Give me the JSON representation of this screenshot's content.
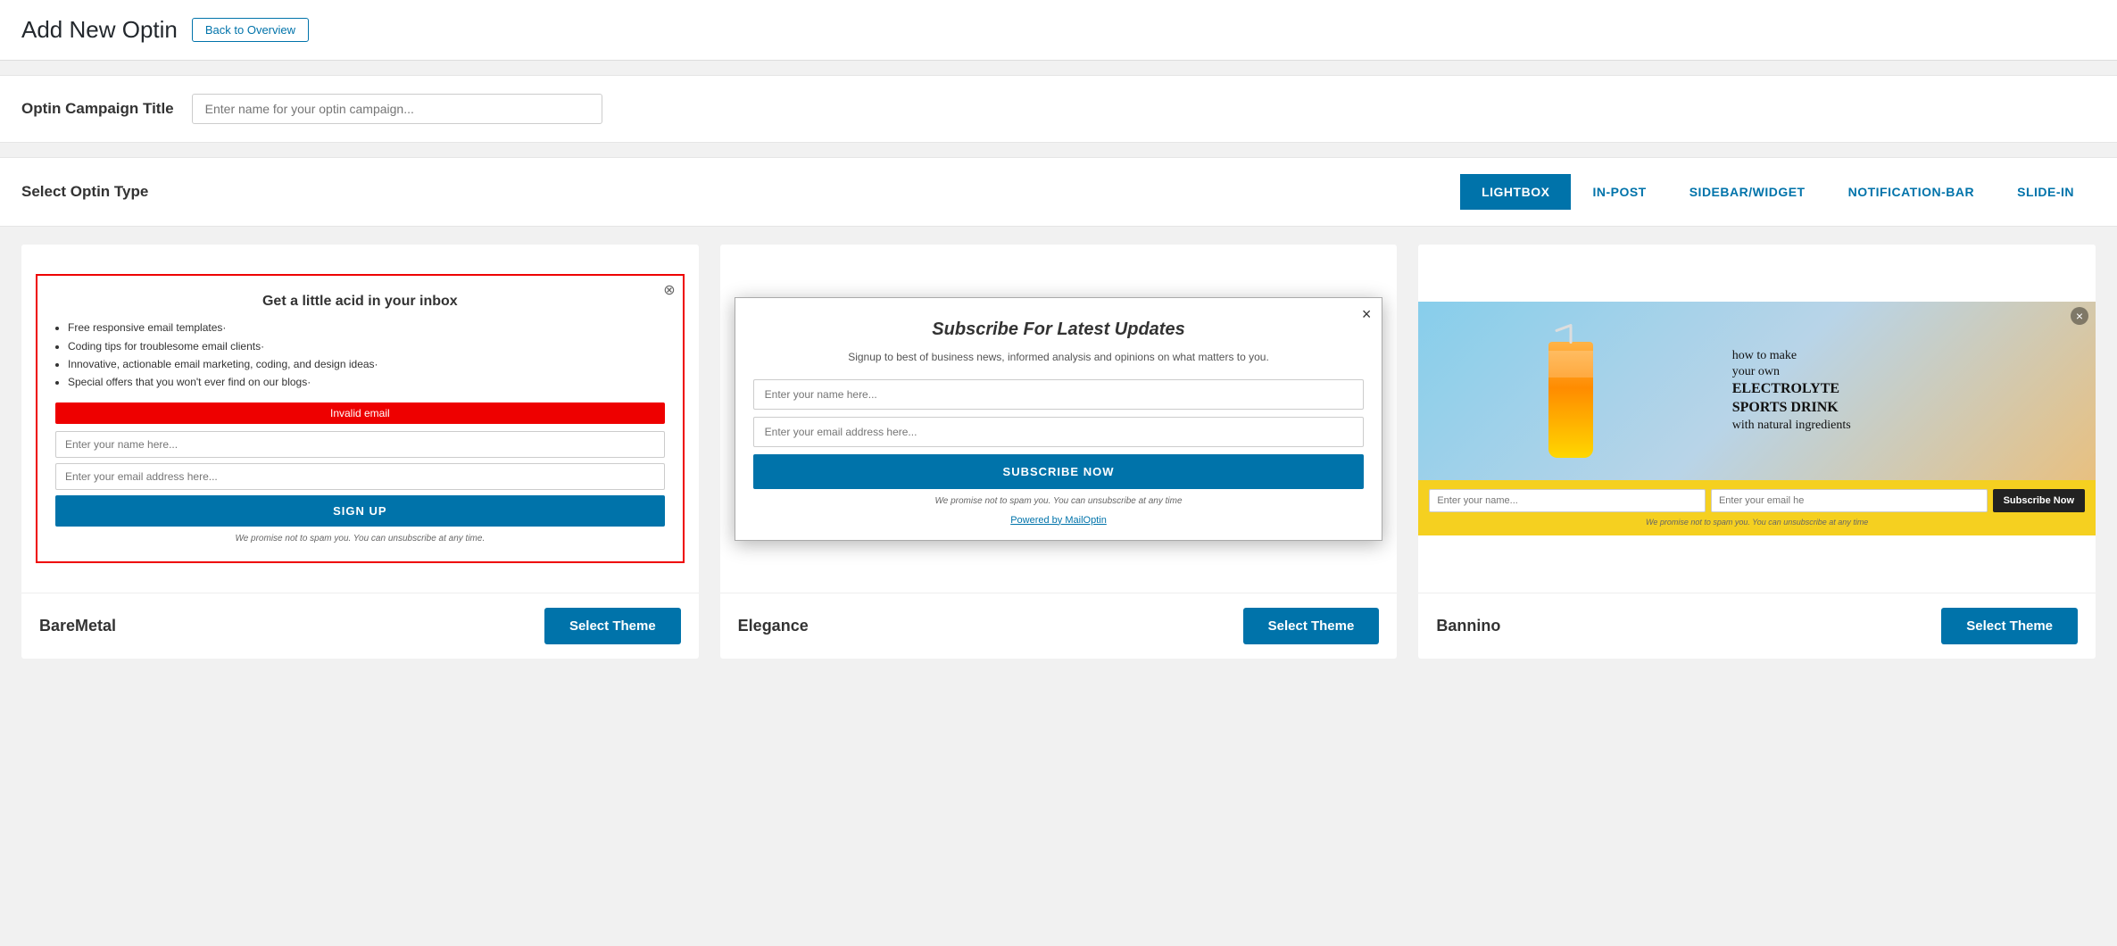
{
  "header": {
    "title": "Add New Optin",
    "back_btn": "Back to Overview"
  },
  "campaign_title": {
    "label": "Optin Campaign Title",
    "placeholder": "Enter name for your optin campaign..."
  },
  "optin_type": {
    "label": "Select Optin Type",
    "tabs": [
      {
        "id": "lightbox",
        "label": "LIGHTBOX",
        "active": true
      },
      {
        "id": "in-post",
        "label": "IN-POST",
        "active": false
      },
      {
        "id": "sidebar",
        "label": "SIDEBAR/WIDGET",
        "active": false
      },
      {
        "id": "notification",
        "label": "NOTIFICATION-BAR",
        "active": false
      },
      {
        "id": "slide-in",
        "label": "SLIDE-IN",
        "active": false
      }
    ]
  },
  "themes": [
    {
      "id": "baremetal",
      "name": "BareMetal",
      "select_label": "Select Theme",
      "preview": {
        "title": "Get a little acid in your inbox",
        "list_items": [
          "Free responsive email templates·",
          "Coding tips for troublesome email clients·",
          "Innovative, actionable email marketing, coding, and design ideas·",
          "Special offers that you won't ever find on our blogs·"
        ],
        "error_text": "Invalid email",
        "name_placeholder": "Enter your name here...",
        "email_placeholder": "Enter your email address here...",
        "btn_label": "SIGN UP",
        "footnote": "We promise not to spam you. You can unsubscribe at any time."
      }
    },
    {
      "id": "elegance",
      "name": "Elegance",
      "select_label": "Select Theme",
      "preview": {
        "title": "Subscribe For Latest Updates",
        "subtitle": "Signup to best of business news, informed analysis and opinions on what matters to you.",
        "name_placeholder": "Enter your name here...",
        "email_placeholder": "Enter your email address here...",
        "btn_label": "SUBSCRIBE NOW",
        "footnote": "We promise not to spam you. You can unsubscribe at any time",
        "powered_by": "Powered by MailOptin"
      }
    },
    {
      "id": "bannino",
      "name": "Bannino",
      "select_label": "Select Theme",
      "preview": {
        "headline_line1": "how to make",
        "headline_line2": "your own",
        "headline_bold": "ELECTROLYTE SPORTS DRINK",
        "headline_end": "with natural ingredients",
        "name_placeholder": "Enter your name...",
        "email_placeholder": "Enter your email he",
        "btn_label": "Subscribe Now",
        "footnote": "We promise not to spam you. You can unsubscribe at any time"
      }
    }
  ]
}
